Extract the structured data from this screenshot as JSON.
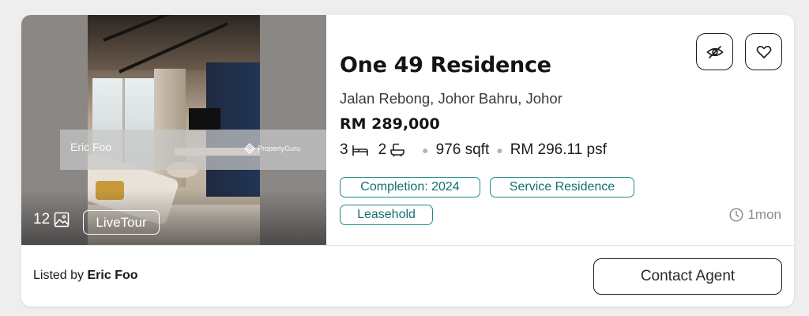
{
  "listing": {
    "title": "One 49 Residence",
    "address": "Jalan Rebong, Johor Bahru, Johor",
    "price": "RM 289,000",
    "bedrooms": "3",
    "bathrooms": "2",
    "area": "976 sqft",
    "psf": "RM 296.11 psf",
    "tags": [
      "Completion: 2024",
      "Service Residence",
      "Leasehold"
    ],
    "posted": "1mon"
  },
  "media": {
    "photo_count": "12",
    "live_tour_label": "LiveTour",
    "watermark_agent": "Eric Foo",
    "watermark_brand": "PropertyGuru"
  },
  "footer": {
    "listed_by_prefix": "Listed by",
    "agent_name": "Eric Foo",
    "contact_label": "Contact Agent"
  },
  "icons": {
    "hide": "eye-slash-icon",
    "favorite": "heart-icon",
    "bed": "bed-icon",
    "bath": "bathtub-icon",
    "gallery": "image-icon",
    "clock": "clock-icon"
  },
  "colors": {
    "tag_border": "#1f8a8a",
    "tag_text": "#136f6f",
    "muted": "#8d8d8d"
  }
}
